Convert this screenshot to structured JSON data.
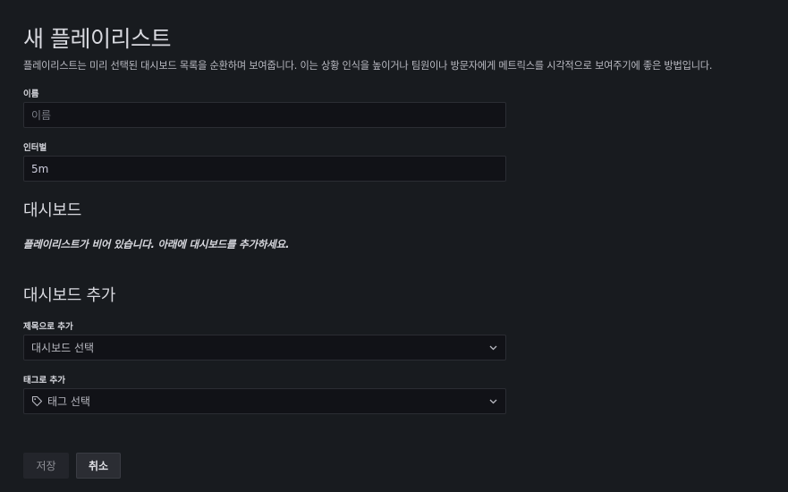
{
  "header": {
    "title": "새 플레이리스트",
    "description": "플레이리스트는 미리 선택된 대시보드 목록을 순환하며 보여줍니다. 이는 상황 인식을 높이거나 팀원이나 방문자에게 메트릭스를 시각적으로 보여주기에 좋은 방법입니다."
  },
  "form": {
    "name_label": "이름",
    "name_placeholder": "이름",
    "name_value": "",
    "interval_label": "인터벌",
    "interval_value": "5m"
  },
  "dashboards": {
    "title": "대시보드",
    "empty_message": "플레이리스트가 비어 있습니다. 아래에 대시보드를 추가하세요."
  },
  "add_dashboards": {
    "title": "대시보드 추가",
    "by_title_label": "제목으로 추가",
    "by_title_placeholder": "대시보드 선택",
    "by_tag_label": "태그로 추가",
    "by_tag_placeholder": "태그 선택"
  },
  "actions": {
    "save_label": "저장",
    "cancel_label": "취소"
  },
  "icons": {
    "chevron": "chevron-down-icon",
    "tag": "tag-icon"
  }
}
